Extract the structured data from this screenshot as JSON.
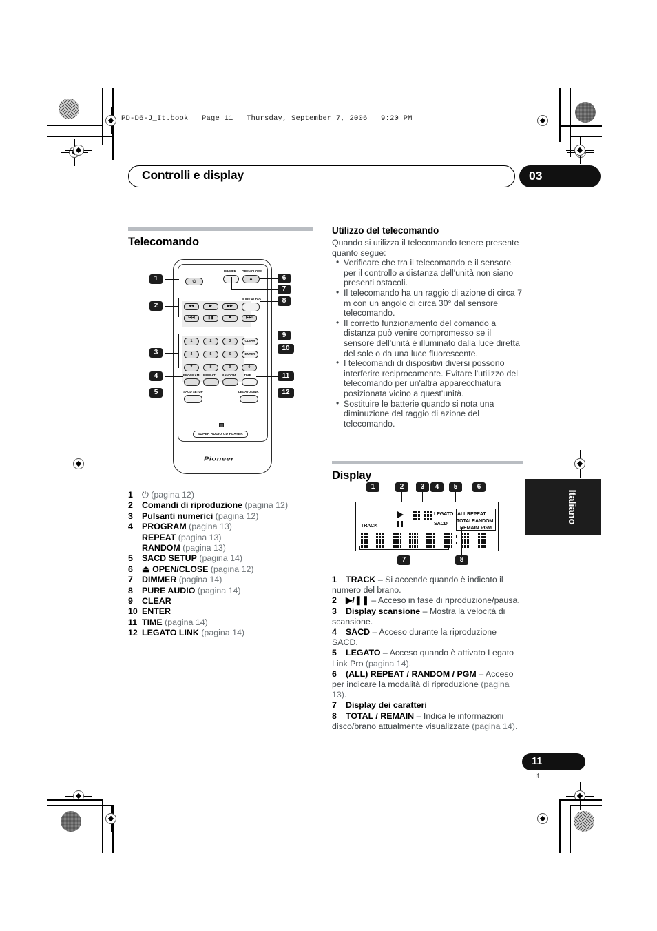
{
  "print": {
    "file_stamp": "PD-D6-J_It.book   Page 11   Thursday, September 7, 2006   9:20 PM"
  },
  "header": {
    "chapter_title": "Controlli e display",
    "chapter_number": "03"
  },
  "side_tab": {
    "language": "Italiano"
  },
  "footer": {
    "page_number": "11",
    "page_suffix": "It"
  },
  "left_column": {
    "section_title": "Telecomando",
    "remote": {
      "brand": "Pioneer",
      "bottom_pill": "SUPER AUDIO CD PLAYER",
      "labels": {
        "dimmer": "DIMMER",
        "open_close": "OPEN/CLOSE",
        "pure_audio": "PURE AUDIO",
        "program": "PROGRAM",
        "repeat": "REPEAT",
        "random": "RANDOM",
        "time": "TIME",
        "sacd_setup": "SACD SETUP",
        "legato_link": "LEGATO LINK",
        "clear": "CLEAR",
        "enter": "ENTER"
      },
      "transport": {
        "rev_scan": "◀◀",
        "play": "▶",
        "fwd_scan": "▶▶",
        "prev": "I◀◀",
        "pause": "❚❚",
        "stop": "■",
        "next": "▶▶I"
      },
      "numeric_keys": [
        "1",
        "2",
        "3",
        "4",
        "5",
        "6",
        "7",
        "8",
        "9",
        "0"
      ],
      "power_glyph": "⏻",
      "eject_glyph": "▲",
      "callouts": [
        "1",
        "2",
        "3",
        "4",
        "5",
        "6",
        "7",
        "8",
        "9",
        "10",
        "11",
        "12"
      ]
    },
    "legend": [
      {
        "n": "1",
        "label": "⏻",
        "bold": false,
        "page": "(pagina 12)"
      },
      {
        "n": "2",
        "label": "Comandi di riproduzione",
        "bold": true,
        "page": "(pagina 12)"
      },
      {
        "n": "3",
        "label": "Pulsanti numerici",
        "bold": true,
        "page": " (pagina 12)"
      },
      {
        "n": "4",
        "label": "PROGRAM",
        "bold": true,
        "page": "(pagina 13)"
      },
      {
        "n": "",
        "label": "REPEAT",
        "bold": true,
        "page": "(pagina 13)"
      },
      {
        "n": "",
        "label": "RANDOM",
        "bold": true,
        "page": "(pagina 13)"
      },
      {
        "n": "5",
        "label": "SACD SETUP",
        "bold": true,
        "page": "(pagina 14)"
      },
      {
        "n": "6",
        "label": "⏏ OPEN/CLOSE",
        "bold": true,
        "page": "(pagina 12)"
      },
      {
        "n": "7",
        "label": "DIMMER",
        "bold": true,
        "page": "(pagina 14)"
      },
      {
        "n": "8",
        "label": "PURE AUDIO",
        "bold": true,
        "page": "(pagina 14)"
      },
      {
        "n": "9",
        "label": "CLEAR",
        "bold": true,
        "page": ""
      },
      {
        "n": "10",
        "label": "ENTER",
        "bold": true,
        "page": ""
      },
      {
        "n": "11",
        "label": "TIME",
        "bold": true,
        "page": "(pagina 14)"
      },
      {
        "n": "12",
        "label": "LEGATO LINK",
        "bold": true,
        "page": "(pagina 14)"
      }
    ]
  },
  "right_column": {
    "usage": {
      "title": "Utilizzo del telecomando",
      "intro": "Quando si utilizza il telecomando tenere presente quanto segue:",
      "bullets": [
        "Verificare che tra il telecomando e il sensore per il controllo a distanza dell'unità non siano presenti ostacoli.",
        "Il telecomando ha un raggio di azione di circa 7 m con un angolo di circa 30° dal sensore telecomando.",
        "Il corretto funzionamento del comando a distanza può venire compromesso se il sensore dell'unità è illuminato dalla luce diretta del sole o da una luce fluorescente.",
        "I telecomandi di dispositivi diversi possono interferire reciprocamente. Evitare l'utilizzo del telecomando per un'altra apparecchiatura posizionata vicino a quest'unità.",
        "Sostituire le batterie quando si nota una diminuzione del raggio di azione del telecomando."
      ]
    },
    "display": {
      "section_title": "Display",
      "diagram": {
        "callouts_top": [
          "1",
          "2",
          "3",
          "4",
          "5",
          "6"
        ],
        "callouts_bottom": [
          "7",
          "8"
        ],
        "indicators": {
          "track": "TRACK",
          "legato": "LEGATO",
          "sacd": "SACD",
          "all": "ALL",
          "repeat": "REPEAT",
          "total": "TOTAL",
          "random": "RANDOM",
          "remain": "REMAIN",
          "pgm": "PGM"
        }
      },
      "legend": [
        {
          "n": "1",
          "term": "TRACK",
          "sep": " – ",
          "desc": "Si accende quando è indicato il numero del brano.",
          "page": ""
        },
        {
          "n": "2",
          "term": "▶/❚❚",
          "sep": " – ",
          "desc": "Acceso in fase di riproduzione/pausa.",
          "page": ""
        },
        {
          "n": "3",
          "term": "Display scansione",
          "sep": " – ",
          "desc": "Mostra la velocità di scansione.",
          "page": ""
        },
        {
          "n": "4",
          "term": "SACD",
          "sep": " – ",
          "desc": "Acceso durante la riproduzione SACD.",
          "page": ""
        },
        {
          "n": "5",
          "term": "LEGATO",
          "sep": " – ",
          "desc": "Acceso quando è attivato Legato Link Pro ",
          "page": "(pagina 14)."
        },
        {
          "n": "6",
          "term": "(ALL) REPEAT / RANDOM / PGM",
          "sep": " – ",
          "desc": "Acceso per indicare la modalità di riproduzione ",
          "page": "(pagina 13)."
        },
        {
          "n": "7",
          "term": "Display dei caratteri",
          "sep": "",
          "desc": "",
          "page": ""
        },
        {
          "n": "8",
          "term": "TOTAL / REMAIN",
          "sep": " – ",
          "desc": "Indica le informazioni disco/brano attualmente visualizzate ",
          "page": "(pagina 14)."
        }
      ]
    }
  }
}
